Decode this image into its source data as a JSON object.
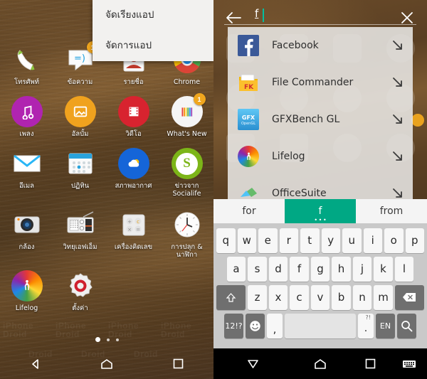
{
  "home": {
    "popup_menu": {
      "name": "app-drawer-options-menu",
      "items": [
        "จัดเรียงแอป",
        "จัดการแอป"
      ]
    },
    "apps": [
      [
        {
          "label": "โทรศัพท์",
          "icon": "phone-icon",
          "badge": ""
        },
        {
          "label": "ข้อความ",
          "icon": "messaging-icon",
          "badge": "1"
        },
        {
          "label": "รายชื่อ",
          "icon": "contacts-icon",
          "badge": ""
        },
        {
          "label": "Chrome",
          "icon": "chrome-icon",
          "badge": ""
        }
      ],
      [
        {
          "label": "เพลง",
          "icon": "music-icon",
          "badge": ""
        },
        {
          "label": "อัลบั้ม",
          "icon": "album-icon",
          "badge": ""
        },
        {
          "label": "วิดีโอ",
          "icon": "video-icon",
          "badge": ""
        },
        {
          "label": "What's New",
          "icon": "whats-new-icon",
          "badge": "1"
        }
      ],
      [
        {
          "label": "อีเมล",
          "icon": "email-icon",
          "badge": ""
        },
        {
          "label": "ปฏิทิน",
          "icon": "calendar-icon",
          "badge": ""
        },
        {
          "label": "สภาพอากาศ",
          "icon": "weather-icon",
          "badge": ""
        },
        {
          "label": "ข่าวจาก Socialife",
          "icon": "socialife-icon",
          "badge": ""
        }
      ],
      [
        {
          "label": "กล้อง",
          "icon": "camera-icon",
          "badge": ""
        },
        {
          "label": "วิทยุเอฟเอ็ม",
          "icon": "fm-radio-icon",
          "badge": ""
        },
        {
          "label": "เครื่องคิดเลข",
          "icon": "calculator-icon",
          "badge": ""
        },
        {
          "label": "การปลุก & นาฬิกา",
          "icon": "alarm-clock-icon",
          "badge": ""
        }
      ],
      [
        {
          "label": "Lifelog",
          "icon": "lifelog-icon",
          "badge": ""
        },
        {
          "label": "ตั้งค่า",
          "icon": "settings-icon",
          "badge": ""
        }
      ]
    ],
    "page_indicator": {
      "pages": 3,
      "active": 1
    },
    "navbar": {
      "back": "back-triangle-icon",
      "home": "home-icon",
      "recents": "recents-square-icon"
    }
  },
  "search": {
    "back_icon": "back-arrow-icon",
    "close_icon": "close-x-icon",
    "query": "f",
    "placeholder": "",
    "results": [
      {
        "label": "Facebook",
        "icon": "facebook-icon",
        "action_icon": "insert-arrow-icon"
      },
      {
        "label": "File Commander",
        "icon": "file-commander-icon",
        "action_icon": "insert-arrow-icon"
      },
      {
        "label": "GFXBench GL",
        "icon": "gfxbench-icon",
        "action_icon": "insert-arrow-icon"
      },
      {
        "label": "Lifelog",
        "icon": "lifelog-icon",
        "action_icon": "insert-arrow-icon"
      },
      {
        "label": "OfficeSuite",
        "icon": "officesuite-icon",
        "action_icon": "insert-arrow-icon"
      }
    ]
  },
  "keyboard": {
    "suggestions": [
      {
        "text": "for",
        "active": false
      },
      {
        "text": "f",
        "active": true
      },
      {
        "text": "from",
        "active": false
      }
    ],
    "row1": [
      "q",
      "w",
      "e",
      "r",
      "t",
      "y",
      "u",
      "i",
      "o",
      "p"
    ],
    "row2": [
      "a",
      "s",
      "d",
      "f",
      "g",
      "h",
      "j",
      "k",
      "l"
    ],
    "row3": [
      "z",
      "x",
      "c",
      "v",
      "b",
      "n",
      "m"
    ],
    "shift_icon": "shift-up-arrow-icon",
    "backspace_icon": "backspace-icon",
    "symbols_label": "12!?",
    "emoji_icon": "emoji-smiley-icon",
    "comma_label": ",",
    "space_label": "",
    "period_label": ".",
    "period_sup": "?!",
    "language_label": "EN",
    "search_key_icon": "search-magnifier-icon",
    "navbar": {
      "hide_keyboard": "down-triangle-icon",
      "home": "home-icon",
      "recents": "recents-square-icon",
      "switch_keyboard": "keyboard-icon"
    }
  },
  "colors": {
    "accent_teal": "#00a884",
    "badge_orange": "#f0a61e",
    "keyboard_bg": "#c9c9c9",
    "key_light": "#f7f7f7",
    "key_dark": "#6f6f6f",
    "navbar_black": "#000000",
    "results_panel": "#e8e7e5"
  }
}
